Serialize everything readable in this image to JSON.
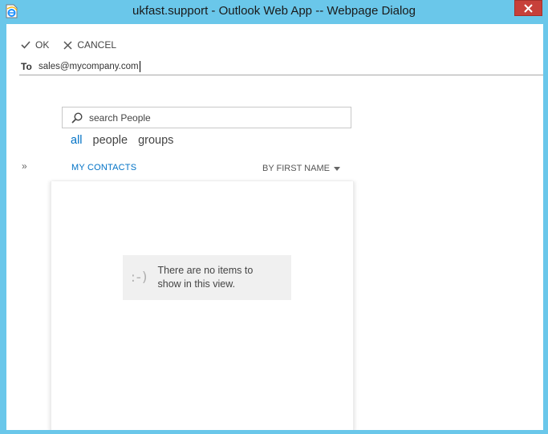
{
  "window": {
    "title": "ukfast.support - Outlook Web App -- Webpage Dialog",
    "app_icon": "ie-page-icon",
    "close_icon": "close-icon"
  },
  "toolbar": {
    "ok_label": "OK",
    "ok_icon": "checkmark-icon",
    "cancel_label": "CANCEL",
    "cancel_icon": "x-icon"
  },
  "recipient": {
    "label": "To",
    "value": "sales@mycompany.com"
  },
  "search": {
    "placeholder": "search People",
    "icon": "search-icon"
  },
  "filters": [
    {
      "label": "all",
      "active": true
    },
    {
      "label": "people",
      "active": false
    },
    {
      "label": "groups",
      "active": false
    }
  ],
  "expand_icon": "»",
  "list": {
    "header": "MY CONTACTS",
    "sort_label": "BY FIRST NAME",
    "empty_face": ":-)",
    "empty_message": "There are no items to show in this view."
  },
  "colors": {
    "frame": "#6ac7ea",
    "accent": "#0072c6",
    "close_button": "#c7403a"
  }
}
